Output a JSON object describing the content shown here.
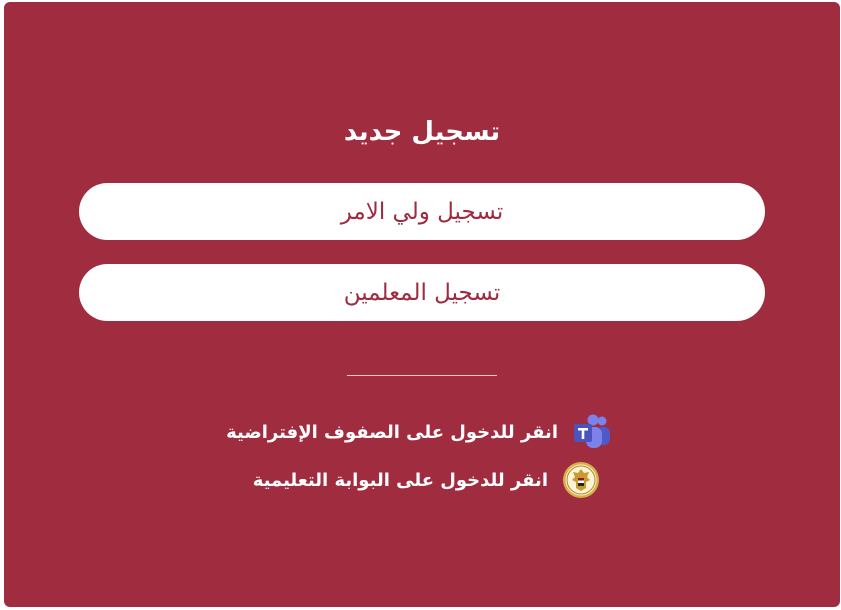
{
  "panel": {
    "background": "#a02c40",
    "title": "تسجيل جديد"
  },
  "buttons": {
    "parent_label": "تسجيل ولي الامر",
    "teacher_label": "تسجيل المعلمين"
  },
  "links": {
    "teams_label": "انقر للدخول على الصفوف الإفتراضية",
    "teams_icon": "microsoft-teams-icon",
    "portal_label": "انقر للدخول على البوابة التعليمية",
    "portal_icon": "ministry-emblem-icon"
  }
}
